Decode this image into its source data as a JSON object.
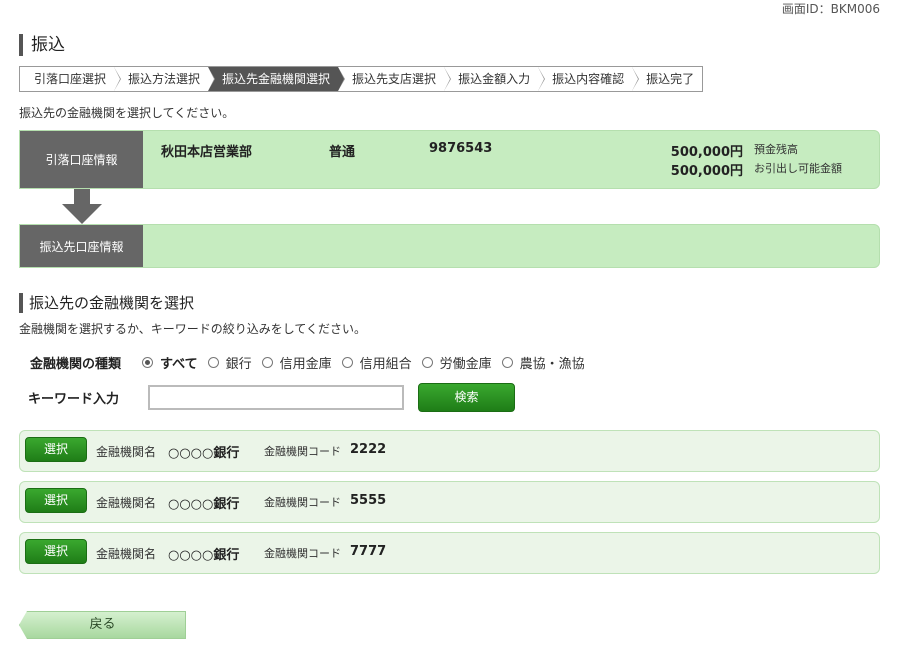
{
  "screen_id": "画面ID：BKM006",
  "page_title": "振込",
  "steps": [
    {
      "label": "引落口座選択",
      "active": false
    },
    {
      "label": "振込方法選択",
      "active": false
    },
    {
      "label": "振込先金融機関選択",
      "active": true
    },
    {
      "label": "振込先支店選択",
      "active": false
    },
    {
      "label": "振込金額入力",
      "active": false
    },
    {
      "label": "振込内容確認",
      "active": false
    },
    {
      "label": "振込完了",
      "active": false
    }
  ],
  "lead_text": "振込先の金融機関を選択してください。",
  "from_account": {
    "label": "引落口座情報",
    "branch": "秋田本店営業部",
    "type": "普通",
    "number": "9876543",
    "balance": "500,000円",
    "balance_label": "預金残高",
    "available": "500,000円",
    "available_label": "お引出し可能金額"
  },
  "to_account": {
    "label": "振込先口座情報"
  },
  "section": {
    "title": "振込先の金融機関を選択",
    "description": "金融機関を選択するか、キーワードの絞り込みをしてください。"
  },
  "filter": {
    "type_label": "金融機関の種類",
    "options": [
      {
        "label": "すべて",
        "selected": true
      },
      {
        "label": "銀行",
        "selected": false
      },
      {
        "label": "信用金庫",
        "selected": false
      },
      {
        "label": "信用組合",
        "selected": false
      },
      {
        "label": "労働金庫",
        "selected": false
      },
      {
        "label": "農協・漁協",
        "selected": false
      }
    ],
    "keyword_label": "キーワード入力",
    "keyword_value": "",
    "search_label": "検索"
  },
  "results": [
    {
      "select_label": "選択",
      "name_label": "金融機関名",
      "name": "○○○○銀行",
      "code_label": "金融機関コード",
      "code": "2222"
    },
    {
      "select_label": "選択",
      "name_label": "金融機関名",
      "name": "○○○○銀行",
      "code_label": "金融機関コード",
      "code": "5555"
    },
    {
      "select_label": "選択",
      "name_label": "金融機関名",
      "name": "○○○○銀行",
      "code_label": "金融機関コード",
      "code": "7777"
    }
  ],
  "back_label": "戻る"
}
